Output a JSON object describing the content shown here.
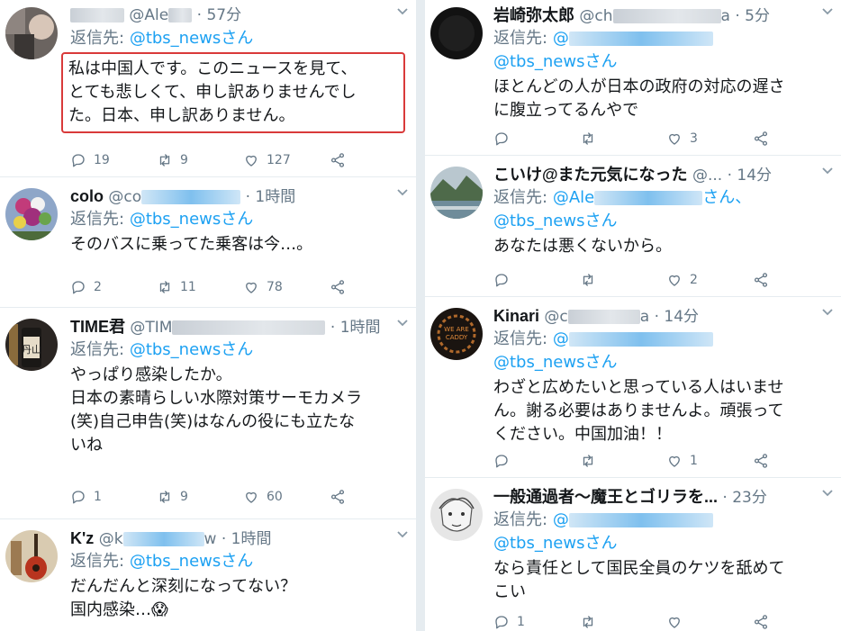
{
  "left_tweets": [
    {
      "name": "",
      "handle": "@Ale",
      "time": "57分",
      "reply_label": "返信先:",
      "reply_to": "@tbs_newsさん",
      "lines": [
        "私は中国人です。このニュースを見て、",
        "とても悲しくて、申し訳ありませんでし",
        "た。日本、申し訳ありません。"
      ],
      "replies": "19",
      "retweets": "9",
      "likes": "127",
      "avatar_icon": "user-avatar-icon",
      "highlighted": true
    },
    {
      "name": "colo",
      "handle": "@co",
      "time": "1時間",
      "reply_label": "返信先:",
      "reply_to": "@tbs_newsさん",
      "lines": [
        "そのバスに乗ってた乗客は今…。"
      ],
      "replies": "2",
      "retweets": "11",
      "likes": "78",
      "avatar_icon": "flower-bouquet-avatar-icon"
    },
    {
      "name": "TIME君",
      "handle": "@TIM",
      "time": "1時間",
      "reply_label": "返信先:",
      "reply_to": "@tbs_newsさん",
      "lines": [
        "やっぱり感染したか。",
        "日本の素晴らしい水際対策サーモカメラ",
        "(笑)自己申告(笑)はなんの役にも立たな",
        "いね"
      ],
      "replies": "1",
      "retweets": "9",
      "likes": "60",
      "avatar_icon": "sake-bottle-avatar-icon"
    },
    {
      "name": "K'z",
      "handle": "@k",
      "handle_tail": "w",
      "time": "1時間",
      "reply_label": "返信先:",
      "reply_to": "@tbs_newsさん",
      "lines": [
        "だんだんと深刻になってない？",
        "国内感染…😱"
      ],
      "avatar_icon": "guitar-avatar-icon"
    }
  ],
  "right_tweets": [
    {
      "name": "岩崎弥太郎",
      "handle": "@ch",
      "handle_tail": "a",
      "time": "5分",
      "reply_label": "返信先:",
      "reply_to": "@tbs_newsさん",
      "lines": [
        "ほとんどの人が日本の政府の対応の遅さ",
        "に腹立ってるんやで"
      ],
      "replies": "",
      "retweets": "",
      "likes": "3",
      "avatar_icon": "dark-avatar-icon"
    },
    {
      "name": "こいけ@また元気になった",
      "handle": "@...",
      "time": "14分",
      "reply_label": "返信先:",
      "reply_extra": "@Ale",
      "reply_extra_tail": "さん、",
      "reply_to": "@tbs_newsさん",
      "lines": [
        "あなたは悪くないから。"
      ],
      "replies": "",
      "retweets": "",
      "likes": "2",
      "avatar_icon": "landscape-avatar-icon"
    },
    {
      "name": "Kinari",
      "handle": "@c",
      "handle_tail": "a",
      "time": "14分",
      "reply_label": "返信先:",
      "reply_to": "@tbs_newsさん",
      "lines": [
        "わざと広めたいと思っている人はいませ",
        "ん。謝る必要はありませんよ。頑張って",
        "ください。中国加油！！"
      ],
      "replies": "",
      "retweets": "",
      "likes": "1",
      "avatar_icon": "wreath-logo-avatar-icon"
    },
    {
      "name": "一般通過者〜魔王とゴリラを...",
      "time": "23分",
      "reply_label": "返信先:",
      "reply_to": "@tbs_newsさん",
      "lines": [
        "なら責任として国民全員のケツを舐めて",
        "こい"
      ],
      "replies": "1",
      "retweets": "",
      "likes": "",
      "avatar_icon": "sketch-face-avatar-icon"
    }
  ],
  "colors": {
    "link": "#1da1f2",
    "muted": "#657786",
    "text": "#14171a",
    "highlight": "#d93a3a",
    "divider": "#e6ecf0"
  }
}
